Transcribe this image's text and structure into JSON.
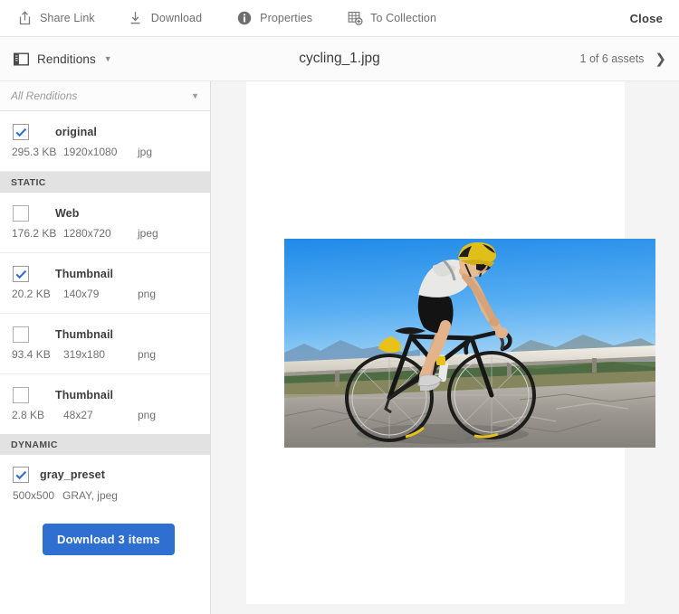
{
  "toolbar": {
    "items": [
      {
        "label": "Share Link",
        "icon": "share-icon"
      },
      {
        "label": "Download",
        "icon": "download-icon"
      },
      {
        "label": "Properties",
        "icon": "info-icon"
      },
      {
        "label": "To Collection",
        "icon": "add-to-collection-icon"
      }
    ],
    "close_label": "Close"
  },
  "subbar": {
    "renditions_label": "Renditions",
    "asset_title": "cycling_1.jpg",
    "asset_count": "1 of 6 assets"
  },
  "panel": {
    "filter": {
      "value": "All Renditions",
      "placeholder": "All Renditions"
    },
    "renditions": [
      {
        "name": "original",
        "size": "295.3 KB",
        "dimensions": "1920x1080",
        "format": "jpg",
        "checked": true
      },
      {
        "name": "Web",
        "size": "176.2 KB",
        "dimensions": "1280x720",
        "format": "jpeg",
        "checked": false
      },
      {
        "name": "Thumbnail",
        "size": "20.2 KB",
        "dimensions": "140x79",
        "format": "png",
        "checked": true
      },
      {
        "name": "Thumbnail",
        "size": "93.4 KB",
        "dimensions": "319x180",
        "format": "png",
        "checked": false
      },
      {
        "name": "Thumbnail",
        "size": "2.8 KB",
        "dimensions": "48x27",
        "format": "png",
        "checked": false
      }
    ],
    "static_header": "STATIC",
    "dynamic_header": "DYNAMIC",
    "dynamic": {
      "name": "gray_preset",
      "dimensions": "500x500",
      "format": "GRAY, jpeg",
      "checked": true
    },
    "download_button": "Download 3 items"
  },
  "preview": {
    "alt": "cyclist riding a road bike on a mountain road"
  },
  "colors": {
    "accent_blue": "#2f6fd0",
    "check_blue": "#2f6fd0",
    "section_header_bg": "#e2e2e2",
    "stage_bg": "#f4f4f4"
  }
}
